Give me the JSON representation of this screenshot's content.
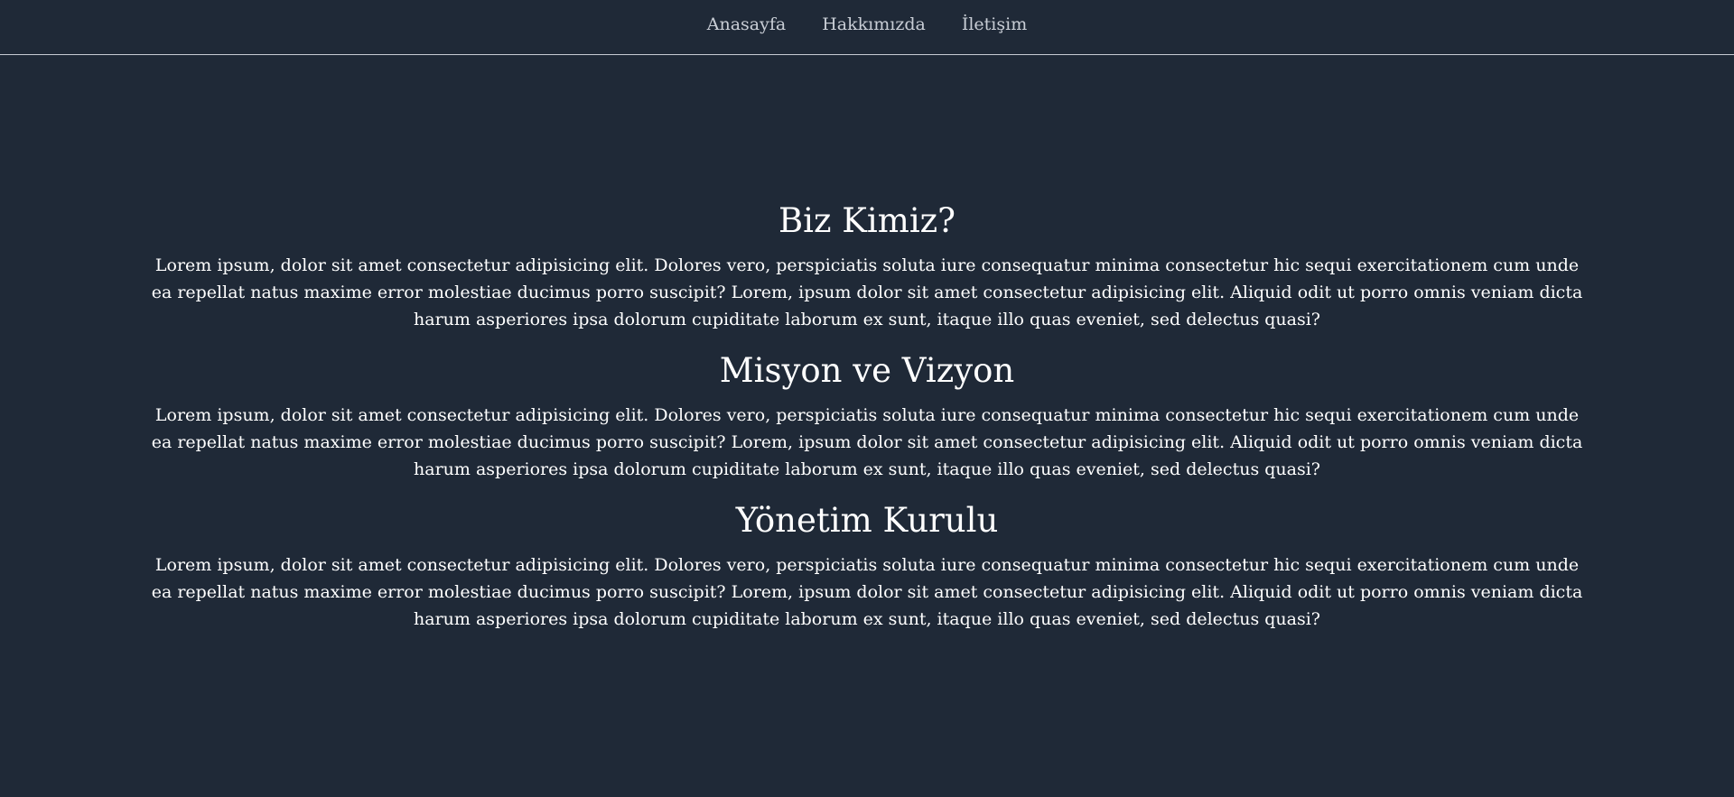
{
  "nav": {
    "items": [
      {
        "label": "Anasayfa"
      },
      {
        "label": "Hakkımızda"
      },
      {
        "label": "İletişim"
      }
    ]
  },
  "sections": [
    {
      "title": "Biz Kimiz?",
      "text": "Lorem ipsum, dolor sit amet consectetur adipisicing elit. Dolores vero, perspiciatis soluta iure consequatur minima consectetur hic sequi exercitationem cum unde ea repellat natus maxime error molestiae ducimus porro suscipit? Lorem, ipsum dolor sit amet consectetur adipisicing elit. Aliquid odit ut porro omnis veniam dicta harum asperiores ipsa dolorum cupiditate laborum ex sunt, itaque illo quas eveniet, sed delectus quasi?"
    },
    {
      "title": "Misyon ve Vizyon",
      "text": "Lorem ipsum, dolor sit amet consectetur adipisicing elit. Dolores vero, perspiciatis soluta iure consequatur minima consectetur hic sequi exercitationem cum unde ea repellat natus maxime error molestiae ducimus porro suscipit? Lorem, ipsum dolor sit amet consectetur adipisicing elit. Aliquid odit ut porro omnis veniam dicta harum asperiores ipsa dolorum cupiditate laborum ex sunt, itaque illo quas eveniet, sed delectus quasi?"
    },
    {
      "title": "Yönetim Kurulu",
      "text": "Lorem ipsum, dolor sit amet consectetur adipisicing elit. Dolores vero, perspiciatis soluta iure consequatur minima consectetur hic sequi exercitationem cum unde ea repellat natus maxime error molestiae ducimus porro suscipit? Lorem, ipsum dolor sit amet consectetur adipisicing elit. Aliquid odit ut porro omnis veniam dicta harum asperiores ipsa dolorum cupiditate laborum ex sunt, itaque illo quas eveniet, sed delectus quasi?"
    }
  ],
  "colors": {
    "background": "#1f2937",
    "nav_text": "#c9ced6",
    "text": "#ffffff",
    "divider": "#c7ccd4"
  }
}
